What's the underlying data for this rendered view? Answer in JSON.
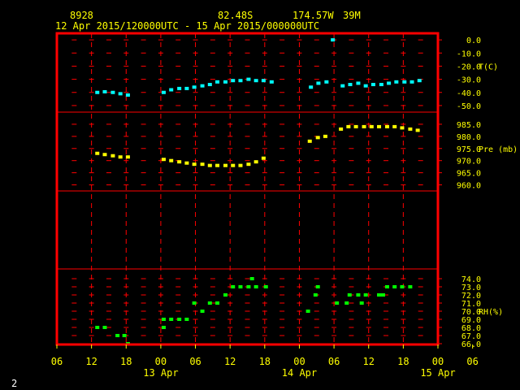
{
  "header": {
    "station": "8928",
    "latitude": "82.48S",
    "longitude": "174.57W",
    "elevation": "39M",
    "period": "12 Apr 2015/120000UTC - 15 Apr 2015/000000UTC"
  },
  "corner_label": "2",
  "colors": {
    "frame": "#ff0000",
    "axis_text": "#ffff00",
    "temperature": "#00ffff",
    "pressure": "#ffff00",
    "humidity": "#00ff00",
    "background": "#000000"
  },
  "chart_data": {
    "type": "scatter",
    "x_axis": {
      "unit": "hours since 12 Apr 2015 06 UTC",
      "range": [
        0,
        66
      ],
      "tick_labels": [
        "06",
        "12",
        "18",
        "00",
        "06",
        "12",
        "18",
        "00",
        "06",
        "12",
        "18",
        "00",
        "06"
      ],
      "date_labels": [
        "13 Apr",
        "14 Apr",
        "15 Apr"
      ]
    },
    "panels": [
      {
        "name": "temperature",
        "ylabel": "T(C)",
        "ylim": [
          -55,
          5
        ],
        "ticks": [
          "0.0",
          "-10.0",
          "-20.0",
          "-30.0",
          "-40.0",
          "-50.0"
        ],
        "tick_values": [
          0,
          -10,
          -20,
          -30,
          -40,
          -50
        ],
        "color": "#00ffff",
        "points": [
          [
            7,
            -40
          ],
          [
            8.3,
            -39.5
          ],
          [
            9.7,
            -40
          ],
          [
            11,
            -41
          ],
          [
            12.3,
            -42
          ],
          [
            18.5,
            -40
          ],
          [
            19.8,
            -38
          ],
          [
            21.2,
            -37
          ],
          [
            22.5,
            -37
          ],
          [
            23.8,
            -36
          ],
          [
            25.2,
            -35
          ],
          [
            26.5,
            -34
          ],
          [
            27.8,
            -32
          ],
          [
            29.2,
            -32
          ],
          [
            30.5,
            -31
          ],
          [
            31.8,
            -31
          ],
          [
            33.2,
            -30
          ],
          [
            34.5,
            -31
          ],
          [
            35.8,
            -31
          ],
          [
            37.2,
            -32
          ],
          [
            44,
            -36
          ],
          [
            45.3,
            -33
          ],
          [
            46.7,
            -32
          ],
          [
            47.8,
            0
          ],
          [
            49.5,
            -35
          ],
          [
            50.8,
            -34
          ],
          [
            52.2,
            -33
          ],
          [
            53.5,
            -35
          ],
          [
            54.8,
            -34
          ],
          [
            56.2,
            -34
          ],
          [
            57.5,
            -33
          ],
          [
            58.8,
            -32
          ],
          [
            60.2,
            -32
          ],
          [
            61.5,
            -32
          ],
          [
            62.8,
            -31
          ]
        ]
      },
      {
        "name": "pressure",
        "ylabel": "Pre (mb)",
        "ylim": [
          957.5,
          990
        ],
        "ticks": [
          "985.0",
          "980.0",
          "975.0",
          "970.0",
          "965.0",
          "960.0"
        ],
        "tick_values": [
          985,
          980,
          975,
          970,
          965,
          960
        ],
        "color": "#ffff00",
        "points": [
          [
            7,
            973
          ],
          [
            8.3,
            972.5
          ],
          [
            9.7,
            972
          ],
          [
            11,
            971.5
          ],
          [
            12.3,
            971.5
          ],
          [
            18.5,
            970.5
          ],
          [
            19.8,
            970
          ],
          [
            21.2,
            969.5
          ],
          [
            22.5,
            969
          ],
          [
            23.8,
            968.5
          ],
          [
            25.2,
            968.5
          ],
          [
            26.5,
            968
          ],
          [
            27.8,
            968
          ],
          [
            29.2,
            968
          ],
          [
            30.5,
            968
          ],
          [
            31.8,
            968
          ],
          [
            33.2,
            968.5
          ],
          [
            34.5,
            969.5
          ],
          [
            35.8,
            971
          ],
          [
            43.8,
            978
          ],
          [
            45.2,
            979.5
          ],
          [
            46.5,
            980
          ],
          [
            49.2,
            983
          ],
          [
            50.5,
            984
          ],
          [
            51.8,
            984
          ],
          [
            53.2,
            984
          ],
          [
            54.5,
            984
          ],
          [
            55.8,
            984
          ],
          [
            57.2,
            984
          ],
          [
            58.5,
            984
          ],
          [
            59.8,
            983.5
          ],
          [
            61.2,
            983
          ],
          [
            62.5,
            982.5
          ]
        ]
      },
      {
        "name": "humidity",
        "ylabel": "RH(%)",
        "ylim": [
          65.9,
          75.2
        ],
        "ticks": [
          "74.0",
          "73.0",
          "72.0",
          "71.0",
          "70.0",
          "69.0",
          "68.0",
          "67.0",
          "66.0"
        ],
        "tick_values": [
          74,
          73,
          72,
          71,
          70,
          69,
          68,
          67,
          66
        ],
        "color": "#00ff00",
        "points": [
          [
            7,
            68
          ],
          [
            8.3,
            68
          ],
          [
            10.5,
            67
          ],
          [
            11.7,
            67
          ],
          [
            12.3,
            66
          ],
          [
            18.5,
            68
          ],
          [
            18.5,
            69
          ],
          [
            19.8,
            69
          ],
          [
            21.2,
            69
          ],
          [
            22.5,
            69
          ],
          [
            23.8,
            71
          ],
          [
            25.2,
            70
          ],
          [
            26.5,
            71
          ],
          [
            27.8,
            71
          ],
          [
            29.2,
            72
          ],
          [
            30.5,
            73
          ],
          [
            31.8,
            73
          ],
          [
            33.2,
            73
          ],
          [
            33.8,
            74
          ],
          [
            34.5,
            73
          ],
          [
            36.2,
            73
          ],
          [
            43.5,
            70
          ],
          [
            44.8,
            72
          ],
          [
            45.2,
            73
          ],
          [
            48.5,
            71
          ],
          [
            50.2,
            71
          ],
          [
            50.7,
            72
          ],
          [
            52.2,
            72
          ],
          [
            52.8,
            71
          ],
          [
            53.5,
            72
          ],
          [
            55.8,
            72
          ],
          [
            56.5,
            72
          ],
          [
            57.2,
            73
          ],
          [
            58.5,
            73
          ],
          [
            59.8,
            73
          ],
          [
            61.2,
            73
          ]
        ]
      }
    ]
  }
}
